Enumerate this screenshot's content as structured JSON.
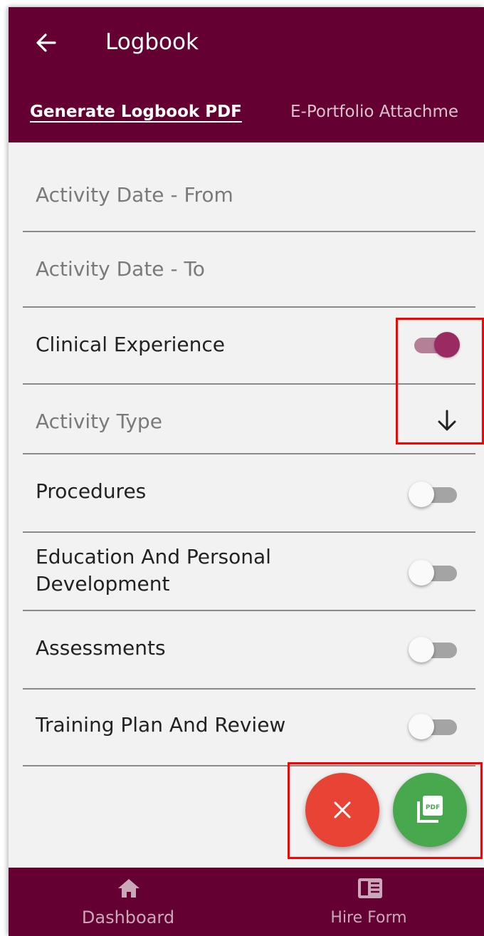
{
  "header": {
    "title": "Logbook",
    "tabs": [
      {
        "label": "Generate Logbook PDF",
        "active": true
      },
      {
        "label": "E-Portfolio Attachme",
        "active": false
      }
    ]
  },
  "form": {
    "date_from_placeholder": "Activity Date - From",
    "date_to_placeholder": "Activity Date - To",
    "activity_type_placeholder": "Activity Type",
    "sections": [
      {
        "label": "Clinical Experience",
        "enabled": true
      },
      {
        "label": "Procedures",
        "enabled": false
      },
      {
        "label_line1": "Education And Personal",
        "label_line2": "Development",
        "enabled": false
      },
      {
        "label": "Assessments",
        "enabled": false
      },
      {
        "label": "Training Plan And Review",
        "enabled": false
      }
    ]
  },
  "fabs": {
    "cancel_icon": "close-icon",
    "generate_icon": "pdf-icon",
    "pdf_badge": "PDF"
  },
  "bottom_nav": [
    {
      "label": "Dashboard",
      "icon": "home-icon"
    },
    {
      "label": "Hire Form",
      "icon": "form-icon"
    }
  ],
  "colors": {
    "primary": "#640032",
    "toggle_on": "#9a2a62",
    "fab_cancel": "#e84334",
    "fab_generate": "#48a84e",
    "annotation": "#ff0000"
  }
}
